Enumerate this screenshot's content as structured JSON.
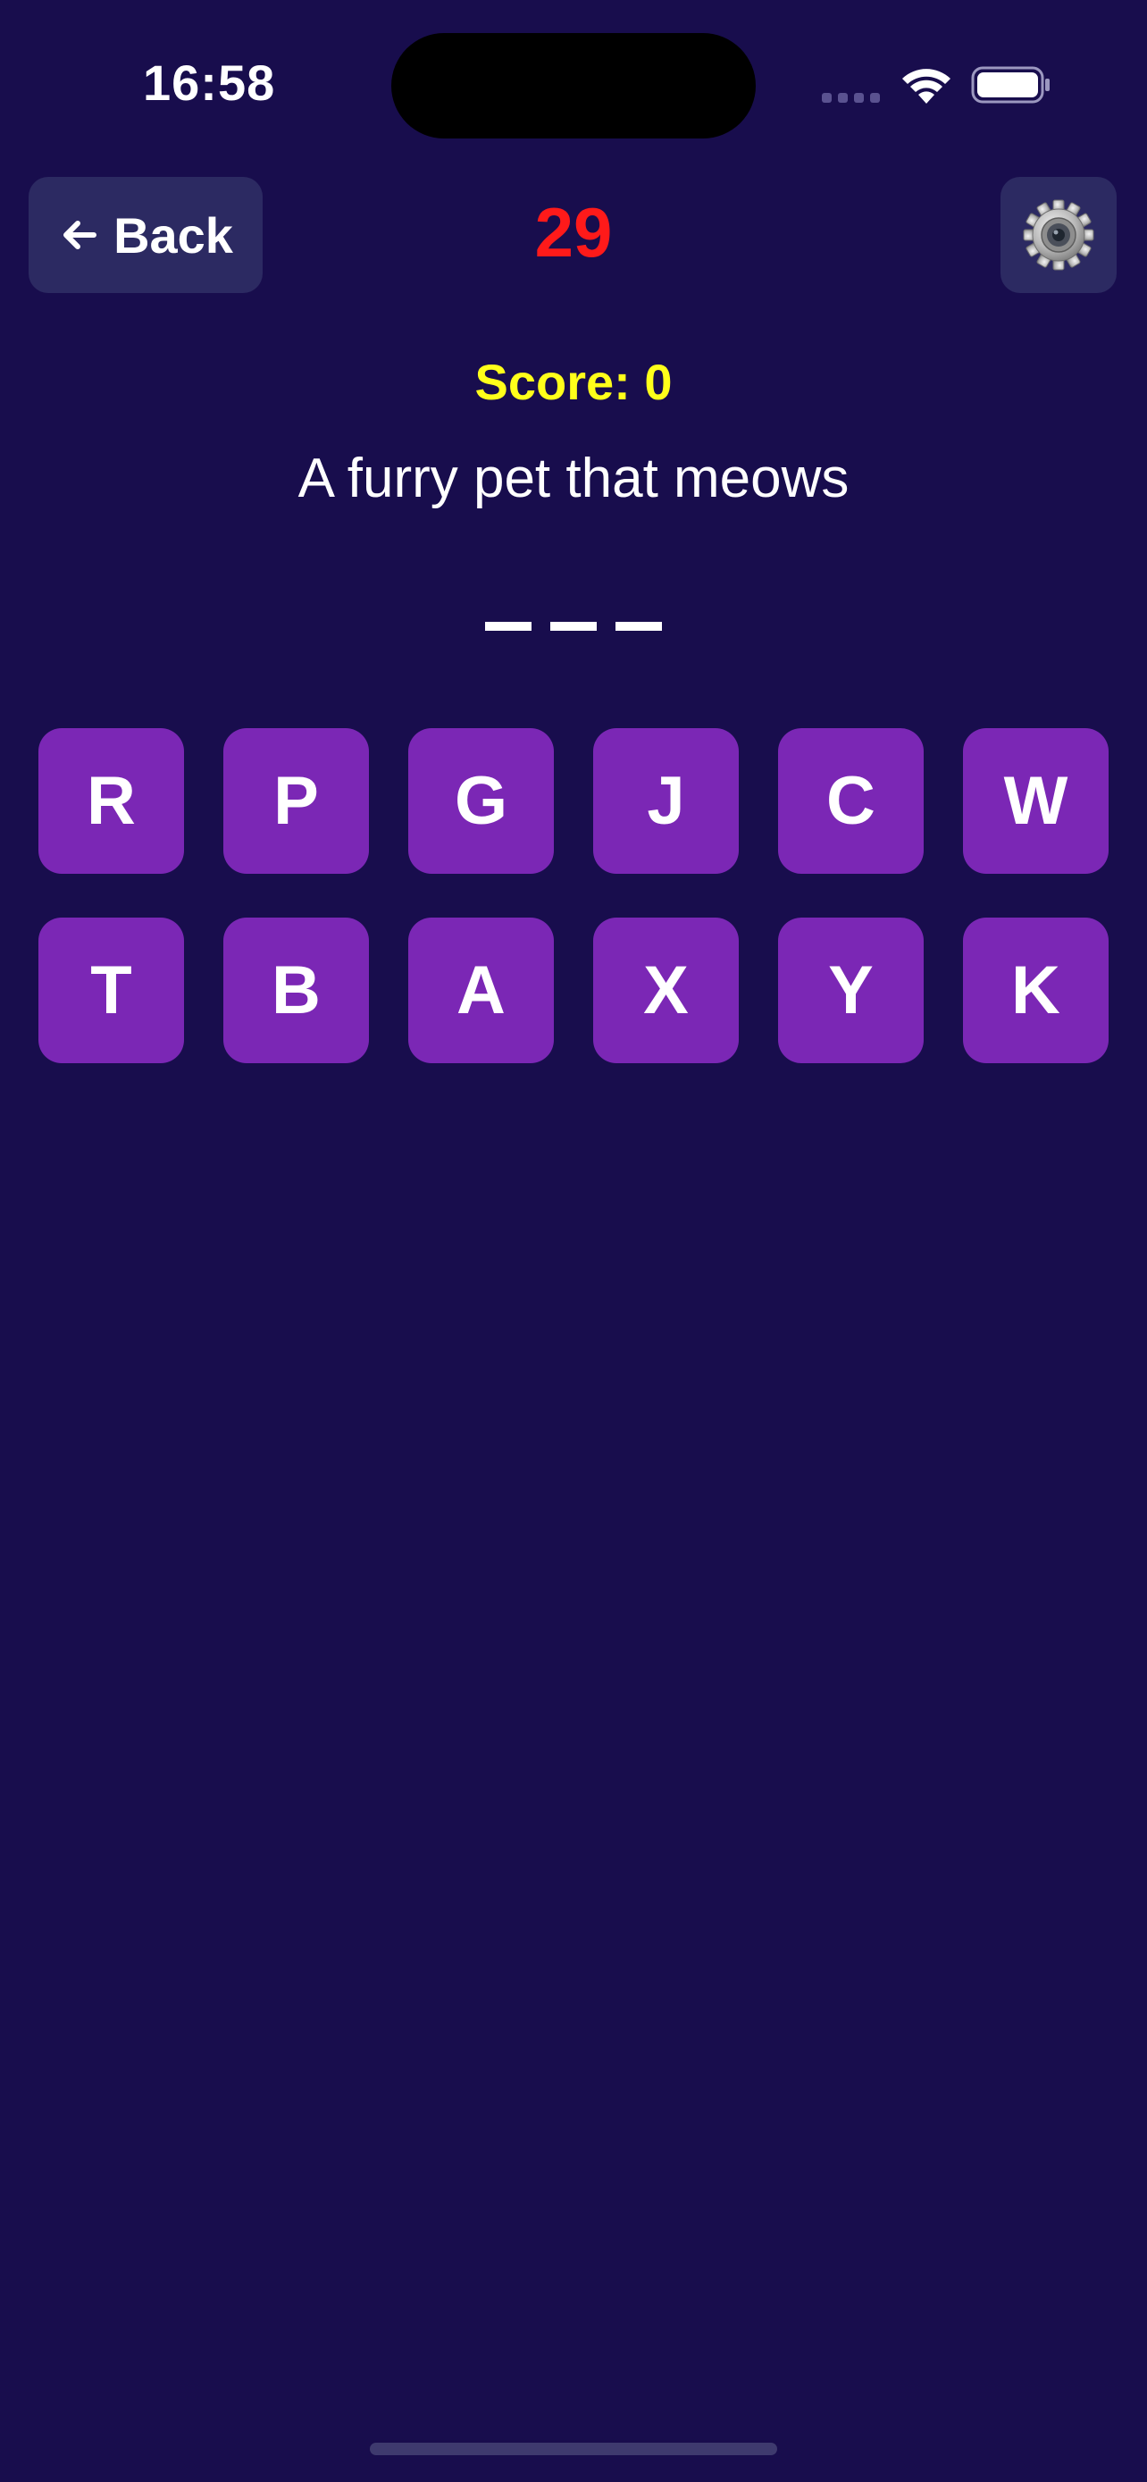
{
  "status_bar": {
    "time": "16:58",
    "icons": [
      "cellular-signal-icon",
      "wifi-icon",
      "battery-icon"
    ]
  },
  "header": {
    "back_label": "Back",
    "back_icon": "arrow-left-icon",
    "timer": "29",
    "settings_icon": "gear-icon"
  },
  "game": {
    "score_text": "Score: 0",
    "clue": "A furry pet that meows",
    "answer_length": 3,
    "letters": [
      "R",
      "P",
      "G",
      "J",
      "C",
      "W",
      "T",
      "B",
      "A",
      "X",
      "Y",
      "K"
    ]
  },
  "colors": {
    "background": "#180d4d",
    "header_button": "#2c2a62",
    "timer": "#ff1a1a",
    "score": "#ffff1a",
    "letter_tile": "#7b27b5",
    "text": "#ffffff"
  }
}
